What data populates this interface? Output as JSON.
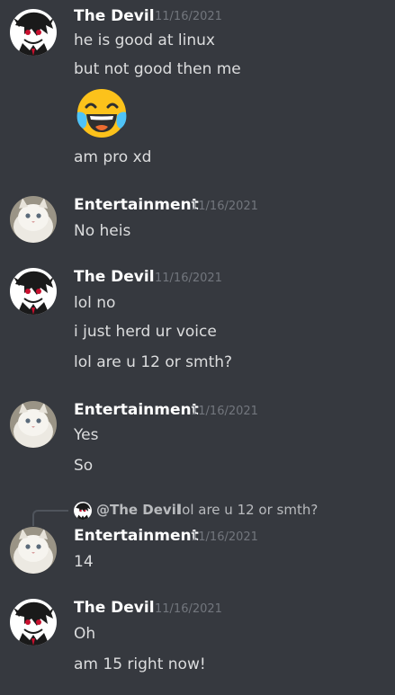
{
  "users": {
    "devil": {
      "name": "The Devil",
      "avatar_icon": "devil-character-avatar-icon"
    },
    "entertainment": {
      "name": "Entertainment",
      "avatar_icon": "white-persian-cat-avatar-icon"
    }
  },
  "groups": [
    {
      "author": "The Devil",
      "timestamp": "11/16/2021",
      "messages": [
        "he is good at linux",
        "but not good then me",
        "😂",
        "am pro xd"
      ]
    },
    {
      "author": "Entertainment",
      "timestamp": "11/16/2021",
      "messages": [
        "No heis"
      ]
    },
    {
      "author": "The Devil",
      "timestamp": "11/16/2021",
      "messages": [
        "lol no",
        "i just herd ur voice",
        "lol are u 12 or smth?"
      ]
    },
    {
      "author": "Entertainment",
      "timestamp": "11/16/2021",
      "messages": [
        "Yes",
        "So"
      ]
    },
    {
      "reply": {
        "author": "@The Devil",
        "text": "lol are u 12 or smth?"
      },
      "author": "Entertainment",
      "timestamp": "11/16/2021",
      "messages": [
        "14"
      ]
    },
    {
      "author": "The Devil",
      "timestamp": "11/16/2021",
      "messages": [
        "Oh",
        "am 15 right now!"
      ]
    }
  ],
  "colors": {
    "background": "#36393f",
    "username": "#ffffff",
    "message_text": "#dcddde",
    "timestamp": "#72767d",
    "reply_text": "#b9bbbe"
  }
}
